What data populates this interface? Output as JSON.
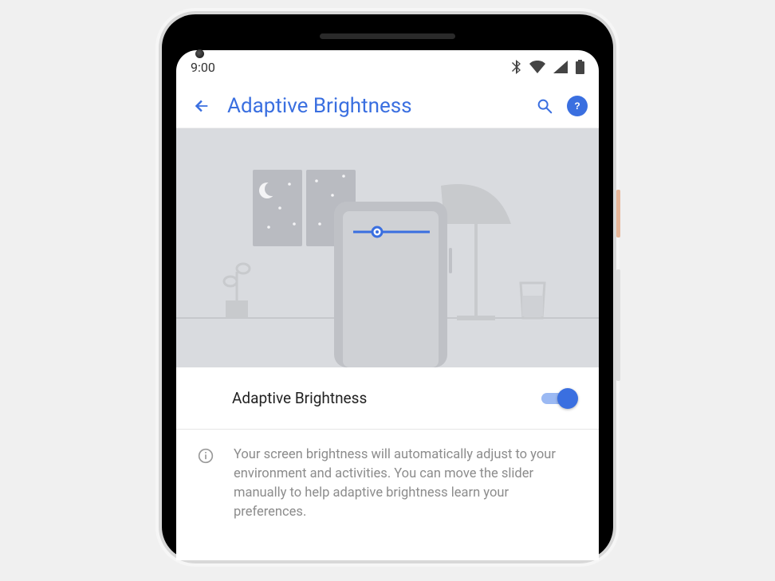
{
  "statusbar": {
    "time": "9:00"
  },
  "appbar": {
    "title": "Adaptive Brightness"
  },
  "setting": {
    "label": "Adaptive Brightness",
    "enabled": true
  },
  "description": {
    "text": "Your screen brightness will automatically adjust to your environment and activities. You can move the slider manually to help adaptive brightness learn your preferences."
  }
}
